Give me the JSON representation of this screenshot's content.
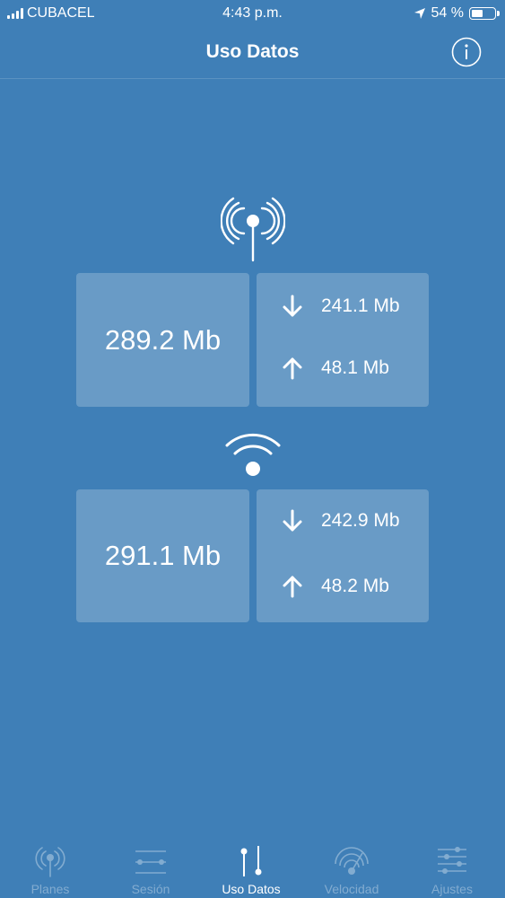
{
  "status_bar": {
    "carrier": "CUBACEL",
    "time": "4:43 p.m.",
    "battery_percent": "54 %",
    "battery_level": 0.54
  },
  "nav": {
    "title": "Uso Datos",
    "info_icon": "info-icon"
  },
  "cellular": {
    "icon": "cellular-antenna-icon",
    "total": "289.2 Mb",
    "download": "241.1 Mb",
    "upload": "48.1 Mb"
  },
  "wifi": {
    "icon": "wifi-icon",
    "total": "291.1 Mb",
    "download": "242.9 Mb",
    "upload": "48.2 Mb"
  },
  "tabs": [
    {
      "label": "Planes",
      "icon": "antenna-icon",
      "active": false
    },
    {
      "label": "Sesión",
      "icon": "session-slider-icon",
      "active": false
    },
    {
      "label": "Uso Datos",
      "icon": "data-usage-icon",
      "active": true
    },
    {
      "label": "Velocidad",
      "icon": "speed-gauge-icon",
      "active": false
    },
    {
      "label": "Ajustes",
      "icon": "settings-sliders-icon",
      "active": false
    }
  ],
  "colors": {
    "background": "#3F7FB7",
    "tile": "rgba(255,255,255,0.22)"
  }
}
